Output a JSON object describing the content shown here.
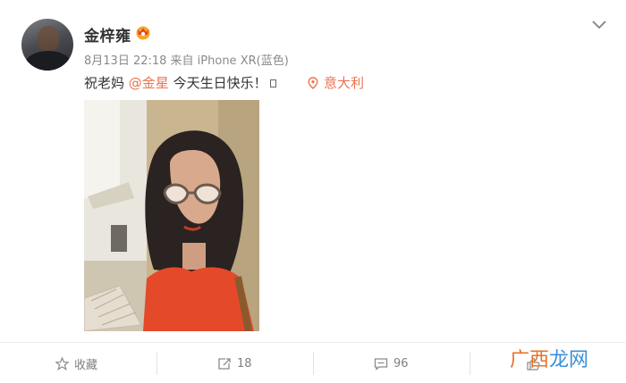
{
  "post": {
    "author": "金梓雍",
    "meta": "8月13日 22:18 来自 iPhone XR(蓝色)",
    "text_prefix": "祝老妈 ",
    "mention": "@金星",
    "text_suffix": " 今天生日快乐！",
    "location": "意大利"
  },
  "actions": {
    "favorite": "收藏",
    "repost_count": "18",
    "comment_count": "96"
  },
  "watermark": {
    "part1": "广西",
    "part2": "龙网"
  },
  "colors": {
    "accent": "#eb7350",
    "meta_gray": "#8a8a8a",
    "text": "#333333"
  }
}
